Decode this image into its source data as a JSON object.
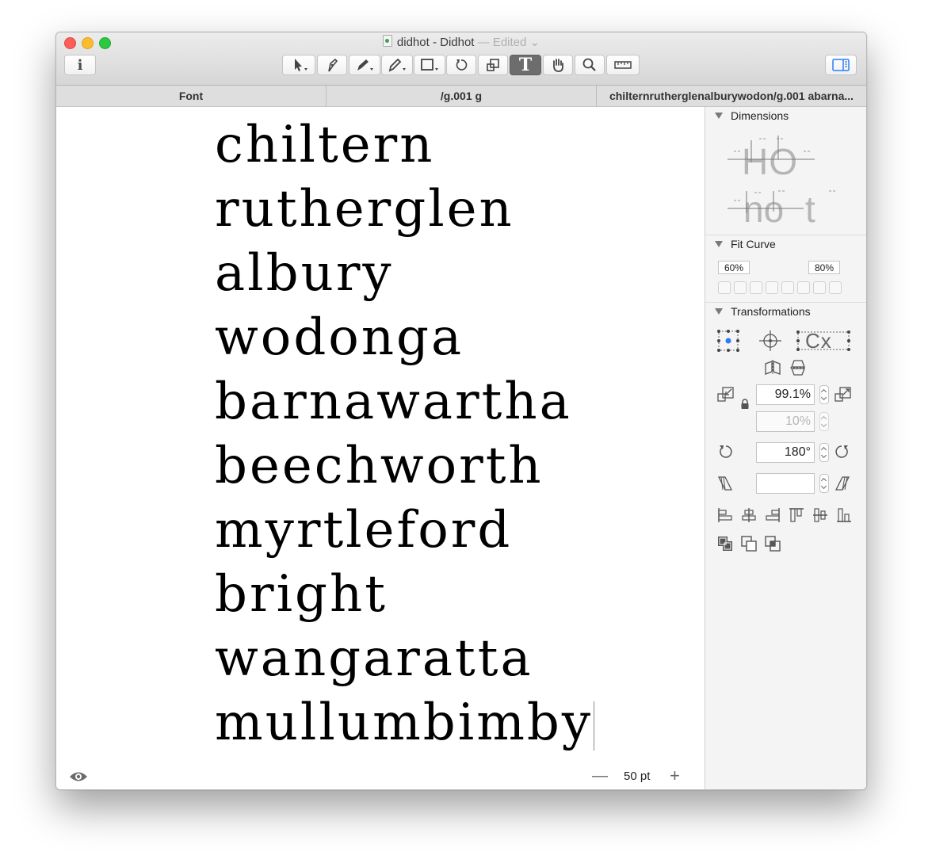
{
  "window": {
    "title": "didhot - Didhot",
    "status": "— Edited ⌄"
  },
  "toolbar": {
    "info_icon": "info-icon",
    "tools": [
      "select",
      "draw",
      "pen",
      "pencil",
      "primitives",
      "rotate",
      "scale",
      "text",
      "hand",
      "zoom",
      "measure"
    ],
    "active_tool": "text",
    "text_tool_glyph": "T"
  },
  "tabs": [
    {
      "label": "Font"
    },
    {
      "label": "/g.001 g"
    },
    {
      "label": "chilternrutherglenalburywodon/g.001 abarna..."
    }
  ],
  "canvas": {
    "lines": [
      "chiltern",
      "rutherglen",
      "albury",
      "wodonga",
      "barnawartha",
      "beechworth",
      "myrtleford",
      "bright",
      "wangaratta",
      "mullumbimby"
    ],
    "font_size": "50 pt",
    "zoom_minus": "—",
    "zoom_plus": "+"
  },
  "panel": {
    "dimensions": {
      "title": "Dimensions",
      "sample_upper": "HO",
      "sample_lower": "no t"
    },
    "fit_curve": {
      "title": "Fit Curve",
      "min": "60%",
      "max": "80%"
    },
    "transformations": {
      "title": "Transformations",
      "origin_text": "Cx",
      "scale_x": "99.1%",
      "scale_y": "10%",
      "rotate": "180°",
      "slant": ""
    }
  },
  "colors": {
    "accent": "#2b7cf7",
    "active_tool_bg": "#6d6d6d"
  }
}
